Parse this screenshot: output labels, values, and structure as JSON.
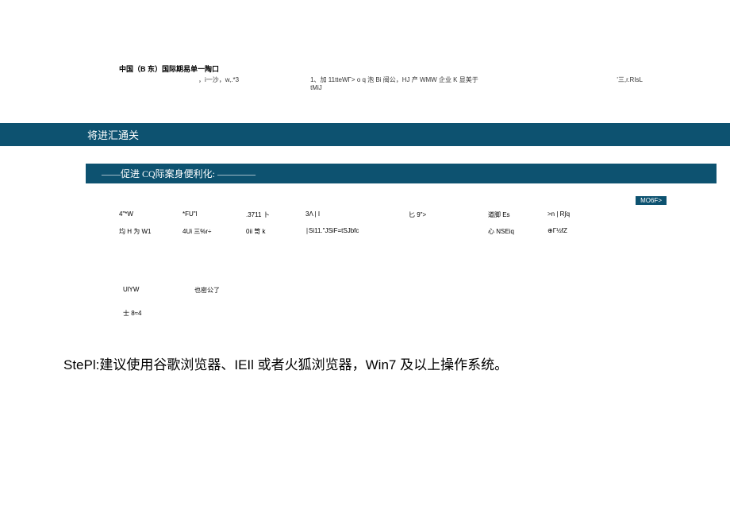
{
  "header": {
    "title": "中国（B 东）国际期易单一陶口",
    "sub_left": "，i一沙，w,.*3",
    "sub_mid": "1、加 11tteWΓ> o q 泡 Bi 阀公，HJ 产 WMW 企业 K 显美于tMiJ",
    "sub_right": "'三,r.RIsL"
  },
  "banner1": "将进汇通关",
  "banner2": "——促进 CQ际案身便利化:  ————",
  "more_badge": "MO6F>",
  "grid": {
    "row1": {
      "c1": "4\"*W",
      "c2": "*FU\"l",
      "c3": ".3711 卜",
      "c4": "3Λ | I",
      "c5": "匕 9\">",
      "c6": "道脚 Es",
      "c7": ">n  |  R∫q"
    },
    "row2": {
      "c1": "均 H 为 W1",
      "c2": "4Ui 三%r÷",
      "c3": "0ii 笥 k",
      "c4": "∣Si11.\"JSiF=tSJbfc",
      "c5": "",
      "c6": "心 NSEiq",
      "c7": "⊕Γ½fZ"
    }
  },
  "lower": {
    "row1_left": "UlYW",
    "row1_right": "也密公了",
    "row2": "士 8≈4"
  },
  "step_text": "StePl:建议使用谷歌浏览器、IEIl 或者火狐浏览器，Win7 及以上操作系统。"
}
